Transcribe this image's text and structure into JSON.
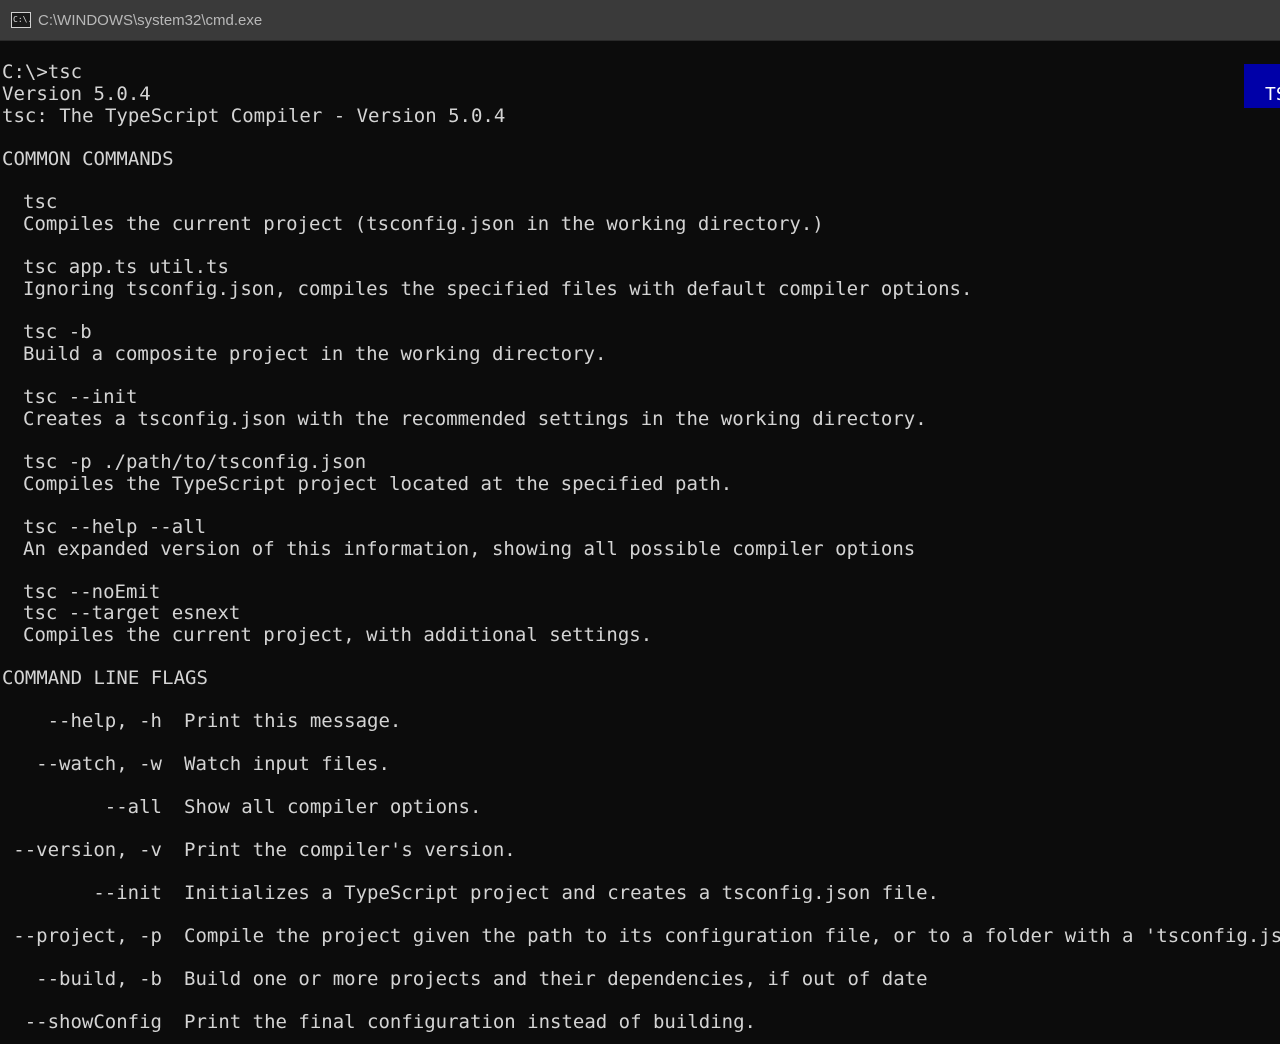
{
  "window": {
    "title": "C:\\WINDOWS\\system32\\cmd.exe",
    "icon_label": "C:\\."
  },
  "badge": {
    "text": "TS",
    "color": "#0000a8"
  },
  "console": {
    "prompt_line": "C:\\>tsc",
    "version_line": "Version 5.0.4",
    "banner_line": "tsc: The TypeScript Compiler - Version 5.0.4",
    "common_heading": "COMMON COMMANDS",
    "common": [
      {
        "cmd": "tsc",
        "desc": "Compiles the current project (tsconfig.json in the working directory.)"
      },
      {
        "cmd": "tsc app.ts util.ts",
        "desc": "Ignoring tsconfig.json, compiles the specified files with default compiler options."
      },
      {
        "cmd": "tsc -b",
        "desc": "Build a composite project in the working directory."
      },
      {
        "cmd": "tsc --init",
        "desc": "Creates a tsconfig.json with the recommended settings in the working directory."
      },
      {
        "cmd": "tsc -p ./path/to/tsconfig.json",
        "desc": "Compiles the TypeScript project located at the specified path."
      },
      {
        "cmd": "tsc --help --all",
        "desc": "An expanded version of this information, showing all possible compiler options"
      }
    ],
    "last_cmd_a": "tsc --noEmit",
    "last_cmd_b": "tsc --target esnext",
    "last_desc": "Compiles the current project, with additional settings.",
    "flags_heading": "COMMAND LINE FLAGS",
    "flags": [
      {
        "flag": "--help, -h",
        "desc": "Print this message."
      },
      {
        "flag": "--watch, -w",
        "desc": "Watch input files."
      },
      {
        "flag": "--all",
        "desc": "Show all compiler options."
      },
      {
        "flag": "--version, -v",
        "desc": "Print the compiler's version."
      },
      {
        "flag": "--init",
        "desc": "Initializes a TypeScript project and creates a tsconfig.json file."
      },
      {
        "flag": "--project, -p",
        "desc": "Compile the project given the path to its configuration file, or to a folder with a 'tsconfig.json'."
      },
      {
        "flag": "--build, -b",
        "desc": "Build one or more projects and their dependencies, if out of date"
      },
      {
        "flag": "--showConfig",
        "desc": "Print the final configuration instead of building."
      }
    ]
  }
}
